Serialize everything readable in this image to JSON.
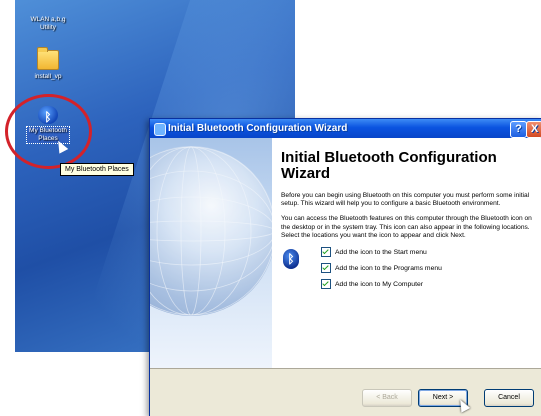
{
  "desktop": {
    "icons": [
      {
        "label": "WLAN a,b,g Utility",
        "icon": "wlan-utility-icon"
      },
      {
        "label": "install_vp",
        "icon": "folder-icon"
      },
      {
        "label": "My Bluetooth Places",
        "icon": "bluetooth-places-icon"
      }
    ],
    "tooltip": "My Bluetooth Places"
  },
  "window": {
    "title": "Initial Bluetooth Configuration Wizard",
    "help_glyph": "?",
    "close_glyph": "X",
    "heading": "Initial Bluetooth Configuration Wizard",
    "para1": "Before you can begin using Bluetooth on this computer you must perform some initial setup. This wizard will help you to configure a basic Bluetooth environment.",
    "para2": "You can access the Bluetooth features on this computer through the Bluetooth icon on the desktop or in the system tray. This icon can also appear in the following locations. Select the locations you want the icon to appear and click Next.",
    "options": [
      {
        "label": "Add the icon to the Start menu",
        "checked": true
      },
      {
        "label": "Add the icon to the Programs menu",
        "checked": true
      },
      {
        "label": "Add the icon to My Computer",
        "checked": true
      }
    ],
    "buttons": {
      "back": "< Back",
      "next": "Next >",
      "cancel": "Cancel"
    }
  },
  "colors": {
    "highlight_ring": "#d3222a",
    "titlebar": "#0a53e0"
  }
}
